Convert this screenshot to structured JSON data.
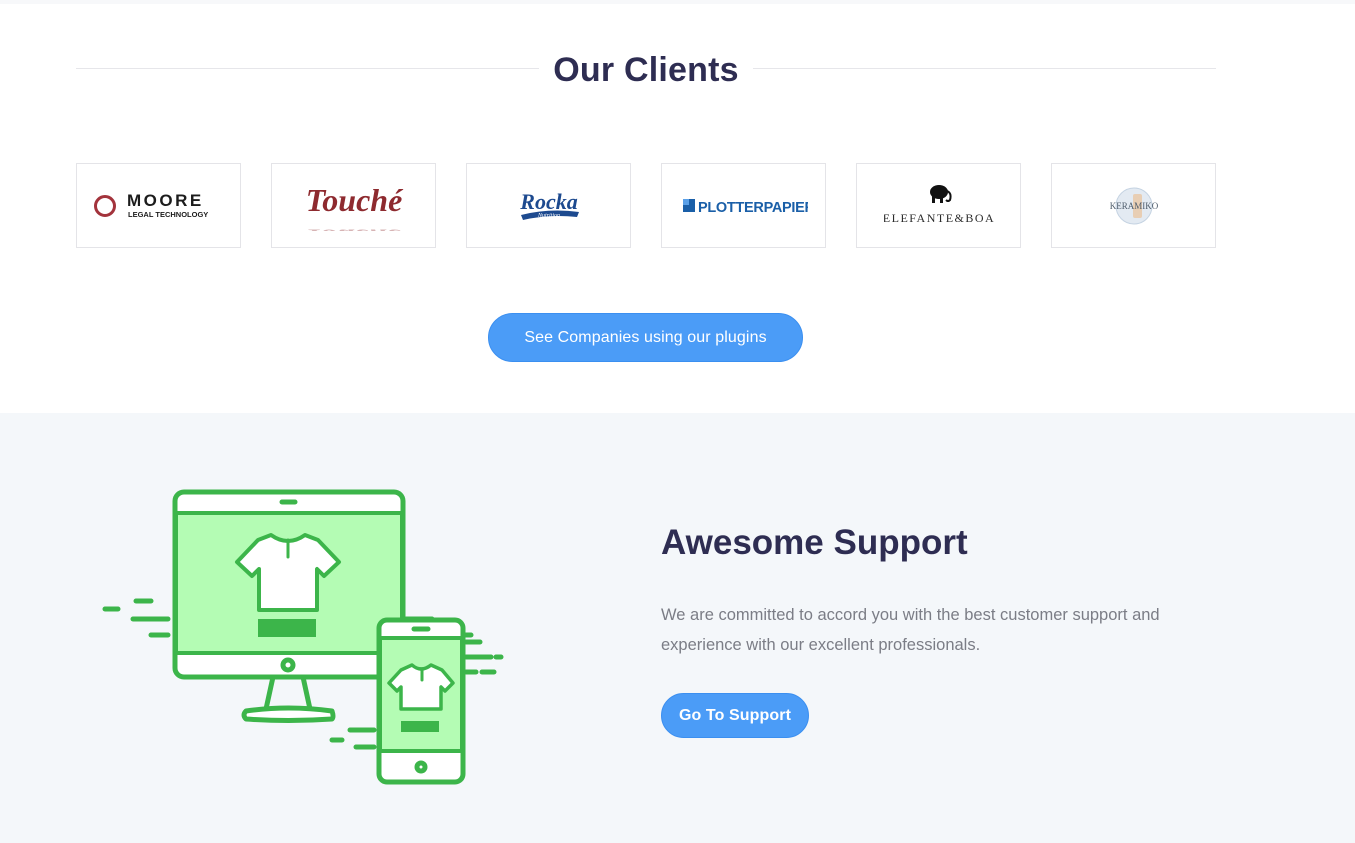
{
  "clients": {
    "title": "Our Clients",
    "logos": [
      {
        "name": "Moore Legal Technology",
        "wordmark": "MOORE",
        "subtitle": "LEGAL TECHNOLOGY",
        "color": "#a3333c"
      },
      {
        "name": "Touché",
        "wordmark": "Touché",
        "color": "#8e2a2f"
      },
      {
        "name": "Rocka Nutrition",
        "wordmark": "Rocka",
        "subtitle": "Nutrition",
        "color": "#1d4a8f"
      },
      {
        "name": "Plotterpapier",
        "wordmark": "PLOTTERPAPIER",
        "color": "#1a5fa8"
      },
      {
        "name": "Elefante & Boa",
        "wordmark": "ELEFANTE&BOA",
        "color": "#2b2b2b"
      },
      {
        "name": "Keramiko",
        "wordmark": "KERAMIKO",
        "color": "#6c7a8a"
      }
    ],
    "cta_label": "See Companies using our plugins"
  },
  "support": {
    "title": "Awesome Support",
    "text": "We are committed to accord you with the best customer support and experience with our excellent professionals.",
    "cta_label": "Go To Support",
    "illustration": "devices-tshirt-icon"
  },
  "colors": {
    "heading": "#2e2d52",
    "accent_blue": "#4b9cf7",
    "illustration_green": "#3cb54a",
    "illustration_fill": "#b4fcb4",
    "support_bg": "#f4f7fa"
  }
}
